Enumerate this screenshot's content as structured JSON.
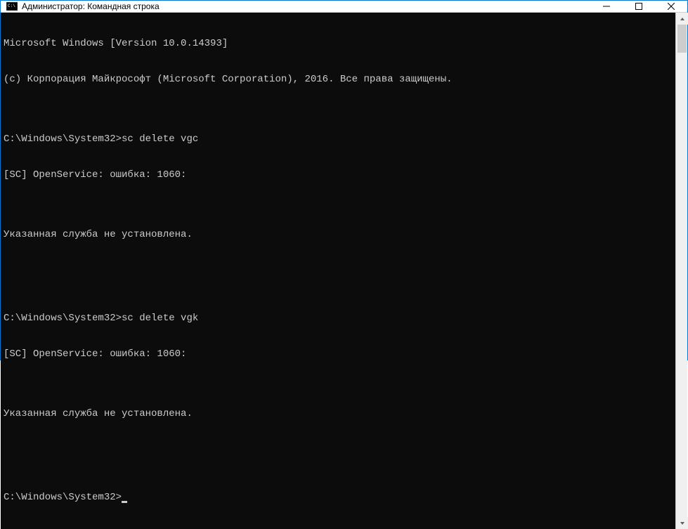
{
  "titlebar": {
    "title": "Администратор: Командная строка"
  },
  "terminal": {
    "lines": [
      "Microsoft Windows [Version 10.0.14393]",
      "(c) Корпорация Майкрософт (Microsoft Corporation), 2016. Все права защищены.",
      "",
      "C:\\Windows\\System32>sc delete vgc",
      "[SC] OpenService: ошибка: 1060:",
      "",
      "Указанная служба не установлена.",
      "",
      "",
      "C:\\Windows\\System32>sc delete vgk",
      "[SC] OpenService: ошибка: 1060:",
      "",
      "Указанная служба не установлена.",
      "",
      "",
      "C:\\Windows\\System32>"
    ]
  }
}
